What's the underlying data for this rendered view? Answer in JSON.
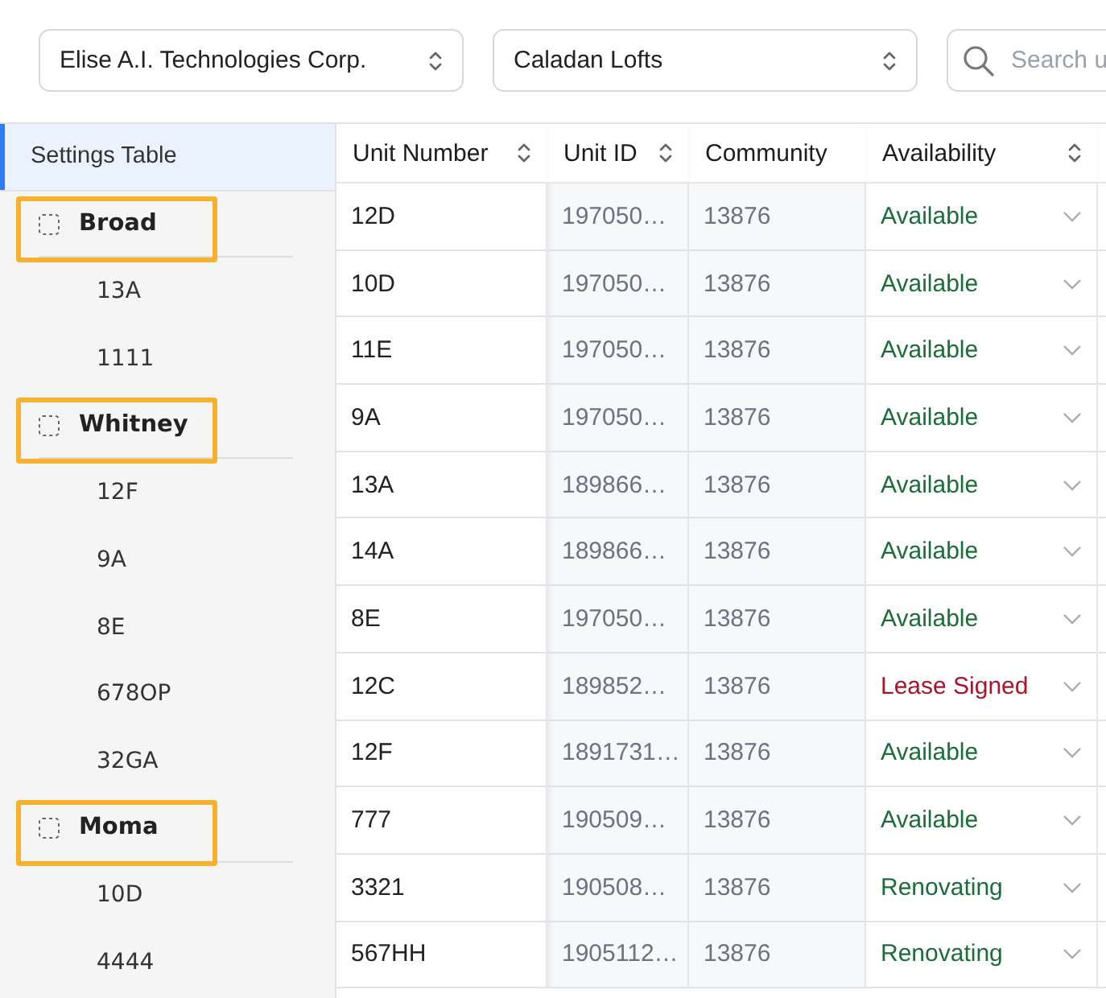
{
  "filters": [
    {
      "kind": "select",
      "value": "Elise A.I. Technologies Corp."
    },
    {
      "kind": "select",
      "value": "Caladan Lofts"
    },
    {
      "kind": "search",
      "placeholder": "Search u"
    }
  ],
  "sidebar": {
    "header": {
      "label": "Settings Table",
      "selected": true
    },
    "groups": [
      {
        "label": "Broad",
        "highlighted": true,
        "children": [
          {
            "label": "13A"
          },
          {
            "label": "1111"
          }
        ]
      },
      {
        "label": "Whitney",
        "highlighted": true,
        "children": [
          {
            "label": "12F"
          },
          {
            "label": "9A"
          },
          {
            "label": "8E"
          },
          {
            "label": "678OP"
          },
          {
            "label": "32GA"
          }
        ]
      },
      {
        "label": "Moma",
        "highlighted": true,
        "children": [
          {
            "label": "10D"
          },
          {
            "label": "4444"
          }
        ]
      }
    ]
  },
  "table": {
    "columns": [
      {
        "label": "Unit Number",
        "sortable": true
      },
      {
        "label": "Unit ID",
        "sortable": true
      },
      {
        "label": "Community",
        "sortable": false
      },
      {
        "label": "Availability",
        "sortable": true
      }
    ],
    "rows": [
      {
        "unit_number": "12D",
        "unit_id": "197050…",
        "community": "13876",
        "availability": "Available",
        "color": "#1b6e37"
      },
      {
        "unit_number": "10D",
        "unit_id": "197050…",
        "community": "13876",
        "availability": "Available",
        "color": "#1b6e37"
      },
      {
        "unit_number": "11E",
        "unit_id": "197050…",
        "community": "13876",
        "availability": "Available",
        "color": "#1b6e37"
      },
      {
        "unit_number": "9A",
        "unit_id": "197050…",
        "community": "13876",
        "availability": "Available",
        "color": "#1b6e37"
      },
      {
        "unit_number": "13A",
        "unit_id": "189866…",
        "community": "13876",
        "availability": "Available",
        "color": "#1b6e37"
      },
      {
        "unit_number": "14A",
        "unit_id": "189866…",
        "community": "13876",
        "availability": "Available",
        "color": "#1b6e37"
      },
      {
        "unit_number": "8E",
        "unit_id": "197050…",
        "community": "13876",
        "availability": "Available",
        "color": "#1b6e37"
      },
      {
        "unit_number": "12C",
        "unit_id": "189852…",
        "community": "13876",
        "availability": "Lease Signed",
        "color": "#a8152b"
      },
      {
        "unit_number": "12F",
        "unit_id": "1891731…",
        "community": "13876",
        "availability": "Available",
        "color": "#1b6e37"
      },
      {
        "unit_number": "777",
        "unit_id": "190509…",
        "community": "13876",
        "availability": "Available",
        "color": "#1b6e37"
      },
      {
        "unit_number": "3321",
        "unit_id": "190508…",
        "community": "13876",
        "availability": "Renovating",
        "color": "#1b6e37"
      },
      {
        "unit_number": "567HH",
        "unit_id": "1905112…",
        "community": "13876",
        "availability": "Renovating",
        "color": "#1b6e37"
      }
    ]
  }
}
